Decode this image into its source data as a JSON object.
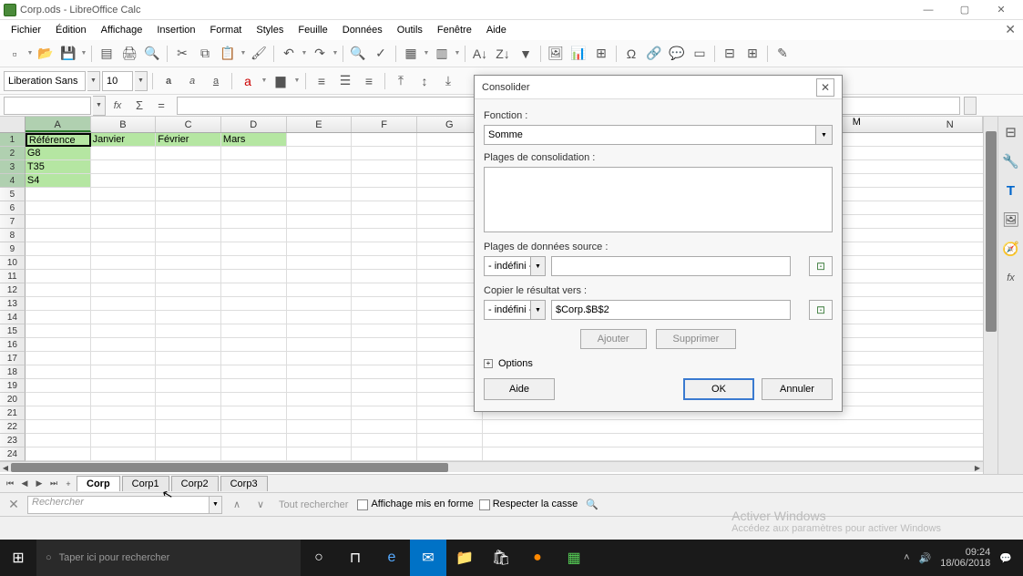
{
  "window": {
    "title": "Corp.ods - LibreOffice Calc"
  },
  "menu": {
    "items": [
      "Fichier",
      "Édition",
      "Affichage",
      "Insertion",
      "Format",
      "Styles",
      "Feuille",
      "Données",
      "Outils",
      "Fenêtre",
      "Aide"
    ]
  },
  "formatbar": {
    "font_name": "Liberation Sans",
    "font_size": "10"
  },
  "namebox": "",
  "columns": [
    "A",
    "B",
    "C",
    "D",
    "E",
    "F",
    "G",
    "M",
    "N"
  ],
  "rows": [
    "1",
    "2",
    "3",
    "4",
    "5",
    "6",
    "7",
    "8",
    "9",
    "10",
    "11",
    "12",
    "13",
    "14",
    "15",
    "16",
    "17",
    "18",
    "19",
    "20",
    "21",
    "22",
    "23",
    "24"
  ],
  "cells": {
    "A1": "Référence",
    "B1": "Janvier",
    "C1": "Février",
    "D1": "Mars",
    "A2": "G8",
    "A3": "T35",
    "A4": "S4"
  },
  "tabs": {
    "nav": [
      "⏮",
      "◀",
      "▶",
      "⏭",
      "+"
    ],
    "sheets": [
      "Corp",
      "Corp1",
      "Corp2",
      "Corp3"
    ],
    "active": "Corp"
  },
  "findbar": {
    "placeholder": "Rechercher",
    "find_all": "Tout rechercher",
    "chk_format": "Affichage mis en forme",
    "chk_case": "Respecter la casse"
  },
  "dialog": {
    "title": "Consolider",
    "lbl_function": "Fonction :",
    "function_value": "Somme",
    "lbl_ranges": "Plages de consolidation :",
    "lbl_source": "Plages de données source :",
    "src_combo": "- indéfini -",
    "src_input": "",
    "lbl_copy": "Copier le résultat vers :",
    "dst_combo": "- indéfini -",
    "dst_input": "$Corp.$B$2",
    "btn_add": "Ajouter",
    "btn_del": "Supprimer",
    "options": "Options",
    "btn_help": "Aide",
    "btn_ok": "OK",
    "btn_cancel": "Annuler"
  },
  "taskbar": {
    "search_placeholder": "Taper ici pour rechercher",
    "time": "09:24",
    "date": "18/06/2018"
  },
  "watermark": {
    "line1": "Activer Windows",
    "line2": "Accédez aux paramètres pour activer Windows"
  }
}
